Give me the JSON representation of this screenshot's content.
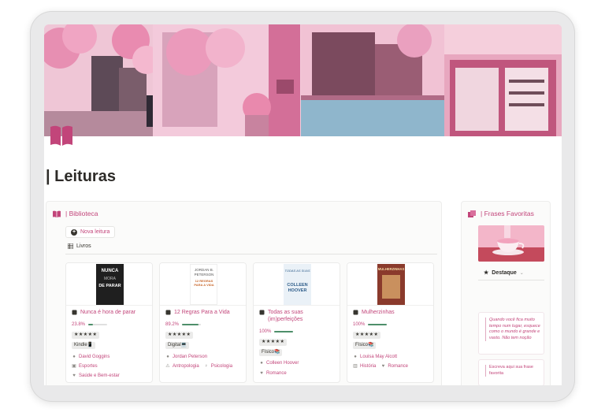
{
  "page": {
    "title": "| Leituras"
  },
  "library": {
    "header": "| Biblioteca",
    "new_button": "Nova leitura",
    "view_tab": "Livros",
    "books": [
      {
        "title": "Nunca é hora de parar",
        "progress_text": "23.8%",
        "progress": 0.238,
        "stars": "★★★★★",
        "format": "Kindle📱",
        "author": "David Goggins",
        "tags": [
          "Esportes",
          "Saúde e Bem-estar"
        ],
        "cover": {
          "top": "NUNCA",
          "mid": "MORA",
          "bottom": "DE PARAR",
          "bg": "#1f1f1f",
          "fg": "#ffffff"
        }
      },
      {
        "title": "12 Regras Para a Vida",
        "progress_text": "89.2%",
        "progress": 0.892,
        "stars": "★★★★★",
        "format": "Digital💻",
        "author": "Jordan Peterson",
        "tags": [
          "Antropologia",
          "Psicologia"
        ],
        "cover": {
          "top": "JORDAN B.",
          "mid": "PETERSON",
          "bottom": "12 REGRAS PARA A VIDA",
          "bg": "#ffffff",
          "fg": "#c96a2f"
        }
      },
      {
        "title": "Todas as suas (im)perfeições",
        "progress_text": "100%",
        "progress": 1.0,
        "stars": "★★★★★",
        "format": "Físico📚",
        "author": "Colleen Hoover",
        "tags": [
          "Romance"
        ],
        "cover": {
          "top": "TODAS AS SUAS",
          "mid": "COLLEEN",
          "bottom": "HOOVER",
          "bg": "#eaf1f7",
          "fg": "#2e5d8a"
        }
      },
      {
        "title": "Mulherzinhas",
        "progress_text": "100%",
        "progress": 1.0,
        "stars": "★★★★★",
        "format": "Físico📚",
        "author": "Louisa May Alcott",
        "tags": [
          "História",
          "Romance"
        ],
        "cover": {
          "top": "MULHERZINHAS",
          "mid": "",
          "bottom": "",
          "bg": "#8a3a2c",
          "fg": "#f3d7a4"
        }
      }
    ]
  },
  "quotes": {
    "header": "| Frases Favoritas",
    "view_tab": "Destaque",
    "items": [
      "Quando você fica muito tempo num lugar, esquece como o mundo é grande e vasto. Não tem noção",
      "Escreva aqui sua frase favorita"
    ]
  },
  "colors": {
    "accent": "#c2457a",
    "progress_fill": "#4e8f6a"
  }
}
